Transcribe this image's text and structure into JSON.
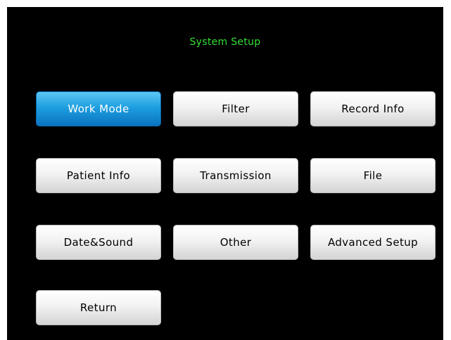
{
  "title": "System Setup",
  "colors": {
    "title_text": "#33e033",
    "background": "#000000",
    "active_button": "#1e9fe0",
    "button": "#f2f2f2"
  },
  "buttons": {
    "work_mode": "Work Mode",
    "filter": "Filter",
    "record_info": "Record Info",
    "patient_info": "Patient Info",
    "transmission": "Transmission",
    "file": "File",
    "date_sound": "Date&Sound",
    "other": "Other",
    "advanced_setup": "Advanced Setup",
    "return": "Return"
  },
  "selected": "Work Mode"
}
